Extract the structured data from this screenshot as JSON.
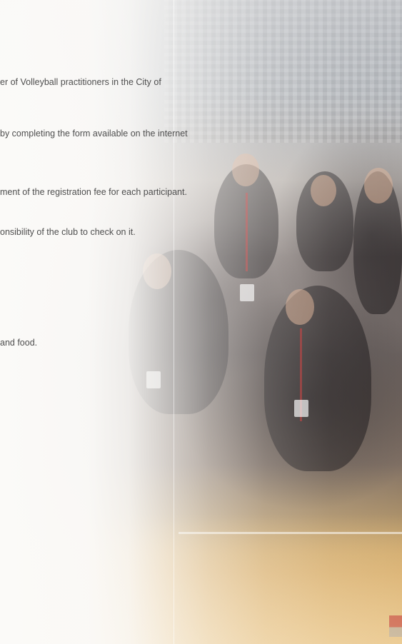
{
  "document": {
    "lines": [
      "er of Volleyball practitioners in the City of",
      "by completing the form available on the internet",
      "ment of the registration fee for each participant.",
      "onsibility of the club to check on it.",
      "and food."
    ]
  },
  "colors": {
    "text": "#4f4f4f",
    "background": "#fbfaf8",
    "floor": "#e0b978"
  }
}
